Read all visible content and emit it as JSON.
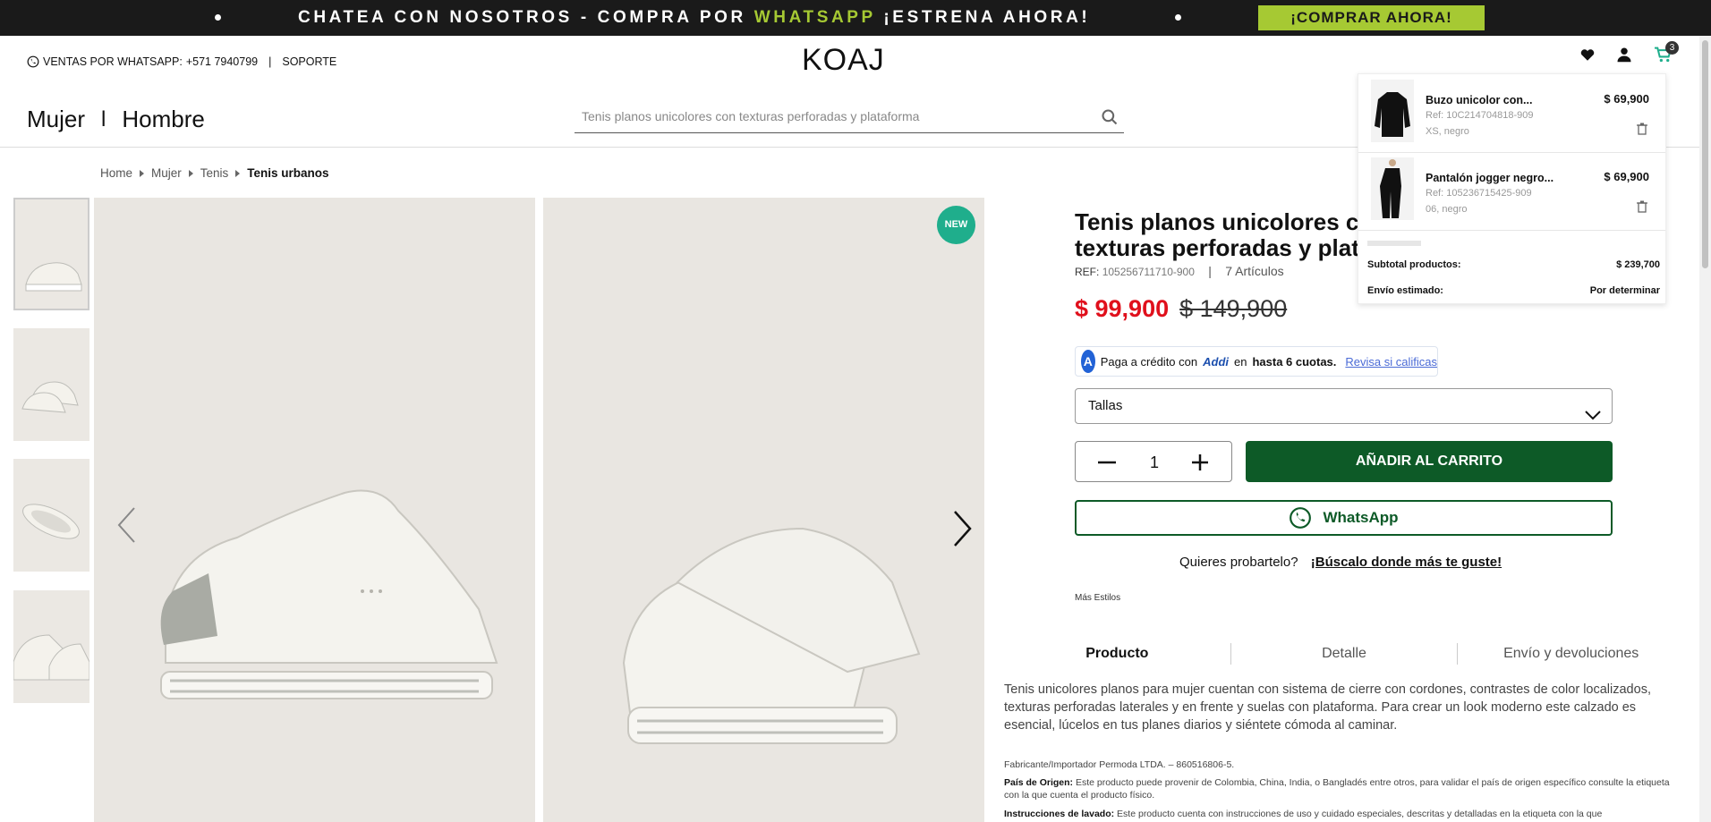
{
  "announcement": {
    "text_part1": "CHATEA CON NOSOTROS - COMPRA POR ",
    "text_highlight": "WHATSAPP",
    "text_part2": " ¡ESTRENA AHORA!",
    "cta": "¡COMPRAR AHORA!"
  },
  "header": {
    "sales_label": "VENTAS POR WHATSAPP:",
    "sales_phone": "+571 7940799",
    "separator": "|",
    "support": "SOPORTE",
    "logo": "KOAJ",
    "cart_count": "3",
    "nav": [
      "Mujer",
      "Hombre"
    ],
    "nav_sep": "l",
    "search_placeholder": "Tenis planos unicolores con texturas perforadas y plataforma"
  },
  "breadcrumb": [
    "Home",
    "Mujer",
    "Tenis",
    "Tenis urbanos"
  ],
  "product": {
    "badge": "NEW",
    "title": "Tenis planos unicolores con texturas perforadas y plataforma",
    "ref_label": "REF:",
    "ref_value": "105256711710-900",
    "ref_sep": "|",
    "articles": "7 Artículos",
    "price": "$ 99,900",
    "old_price": "$ 149,900",
    "addi": {
      "logo_letter": "A",
      "text1": "Paga a crédito con",
      "brand": "Addi",
      "text2": "en",
      "text3": "hasta 6 cuotas.",
      "link": "Revisa si calificas"
    },
    "size_label": "Tallas",
    "quantity": "1",
    "add_to_cart": "AÑADIR AL CARRITO",
    "whatsapp": "WhatsApp",
    "try_text": "Quieres probartelo?",
    "try_link": "¡Búscalo donde más te guste!",
    "more_styles": "Más Estilos",
    "tabs": [
      "Producto",
      "Detalle",
      "Envío y devoluciones"
    ],
    "description": "Tenis unicolores planos para mujer cuentan con sistema de cierre con cordones, contrastes de color localizados, texturas perforadas laterales y en frente y suelas con plataforma. Para crear un look moderno este calzado es esencial, lúcelos en tus planes diarios y siéntete cómoda al caminar.",
    "manufacturer": "Fabricante/Importador Permoda LTDA. – 860516806-5.",
    "origin_label": "País de Origen:",
    "origin_text": "Este producto puede provenir de Colombia, China, India, o Bangladés entre otros, para validar el país de origen específico consulte la etiqueta con la que cuenta el producto físico.",
    "wash_label": "Instrucciones de lavado:",
    "wash_text": "Este producto cuenta con instrucciones de uso y cuidado especiales, descritas y detalladas en la etiqueta con la que"
  },
  "cart": {
    "items": [
      {
        "name": "Buzo unicolor con...",
        "ref": "Ref: 10C214704818-909",
        "variant": "XS, negro",
        "price": "$ 69,900"
      },
      {
        "name": "Pantalón jogger negro...",
        "ref": "Ref: 105236715425-909",
        "variant": "06, negro",
        "price": "$ 69,900"
      }
    ],
    "subtotal_label": "Subtotal productos:",
    "subtotal_value": "$ 239,700",
    "shipping_label": "Envío estimado:",
    "shipping_value": "Por determinar"
  },
  "colors": {
    "sale": "#e0101c",
    "brand_green": "#0d5a27",
    "whatsapp_lime": "#a6c933",
    "new_badge": "#1fae8c"
  }
}
